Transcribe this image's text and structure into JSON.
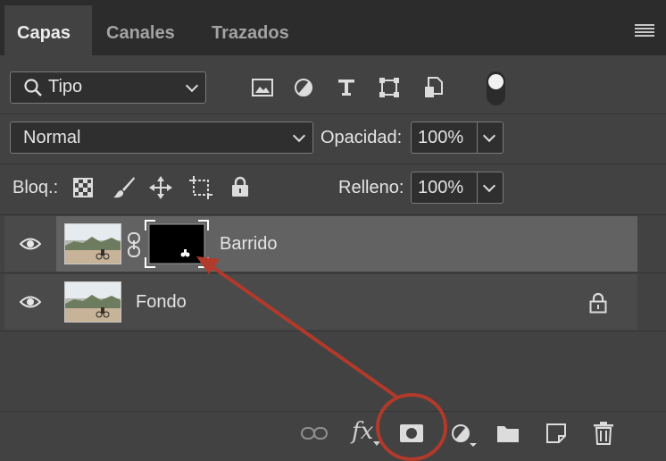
{
  "tabs": [
    {
      "label": "Capas",
      "active": true
    },
    {
      "label": "Canales",
      "active": false
    },
    {
      "label": "Trazados",
      "active": false
    }
  ],
  "filter": {
    "label": "Tipo",
    "icons": [
      "image-filter-icon",
      "adjustment-filter-icon",
      "type-filter-icon",
      "shape-filter-icon",
      "smart-object-filter-icon"
    ]
  },
  "blend": {
    "mode": "Normal",
    "opacity_label": "Opacidad:",
    "opacity_value": "100%"
  },
  "lock": {
    "label": "Bloq.:",
    "fill_label": "Relleno:",
    "fill_value": "100%"
  },
  "layers": [
    {
      "name": "Barrido",
      "visible": true,
      "selected": true,
      "has_mask": true
    },
    {
      "name": "Fondo",
      "visible": true,
      "selected": false,
      "locked": true
    }
  ],
  "bottom_toolbar": {
    "fx_label": "fx"
  },
  "colors": {
    "panel": "#424242",
    "selected_layer": "#626262",
    "annotation": "#b13a2a"
  }
}
